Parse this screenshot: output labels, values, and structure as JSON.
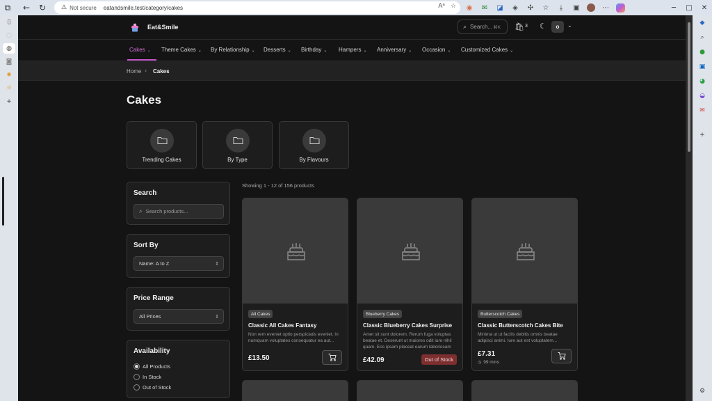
{
  "browser": {
    "security": "Not secure",
    "url": "eatandsmile.test/category/cakes"
  },
  "site": {
    "name": "Eat&Smile",
    "search_placeholder": "Search...",
    "search_shortcut": "⌘K",
    "cart_count": "3",
    "user_initial": "o"
  },
  "nav": {
    "items": [
      {
        "label": "Cakes",
        "active": true
      },
      {
        "label": "Theme Cakes"
      },
      {
        "label": "By Relationship"
      },
      {
        "label": "Desserts"
      },
      {
        "label": "Birthday"
      },
      {
        "label": "Hampers"
      },
      {
        "label": "Anniversary"
      },
      {
        "label": "Occasion"
      },
      {
        "label": "Customized Cakes"
      }
    ]
  },
  "breadcrumb": {
    "home": "Home",
    "current": "Cakes"
  },
  "page_title": "Cakes",
  "subcategories": [
    {
      "label": "Trending Cakes"
    },
    {
      "label": "By Type"
    },
    {
      "label": "By Flavours"
    }
  ],
  "filters": {
    "search": {
      "title": "Search",
      "placeholder": "Search products..."
    },
    "sort": {
      "title": "Sort By",
      "value": "Name: A to Z"
    },
    "price": {
      "title": "Price Range",
      "value": "All Prices"
    },
    "availability": {
      "title": "Availability",
      "options": [
        {
          "label": "All Products",
          "selected": true
        },
        {
          "label": "In Stock",
          "selected": false
        },
        {
          "label": "Out of Stock",
          "selected": false
        }
      ]
    }
  },
  "results": {
    "showing": "Showing 1 - 12 of 156 products"
  },
  "products": [
    {
      "tag": "All Cakes",
      "name": "Classic All Cakes Fantasy",
      "desc": "Non rem eveniet optio perspiciatis eveniet. In numquam voluptates consequatur ea aut...",
      "price": "£13.50"
    },
    {
      "tag": "Blueberry Cakes",
      "name": "Classic Blueberry Cakes Surprise",
      "desc": "Amet sit sunt dolorem. Rerum fuga voluptas beatae et. Deserunt ut maiores odit iure nihil quam. Eos ipsam placeat earum laboriosam",
      "price": "£42.09",
      "status": "Out of Stock"
    },
    {
      "tag": "Butterscotch Cakes",
      "name": "Classic Butterscotch Cakes Bite",
      "desc": "Minima ut ut facilis debitis omnis beatae adipisci animi. Iure aut est voluptatem...",
      "price": "£7.31",
      "time": "99 mins"
    }
  ],
  "colors": {
    "accent": "#c254c7",
    "out_of_stock": "#7d2e2e",
    "background": "#141414"
  }
}
